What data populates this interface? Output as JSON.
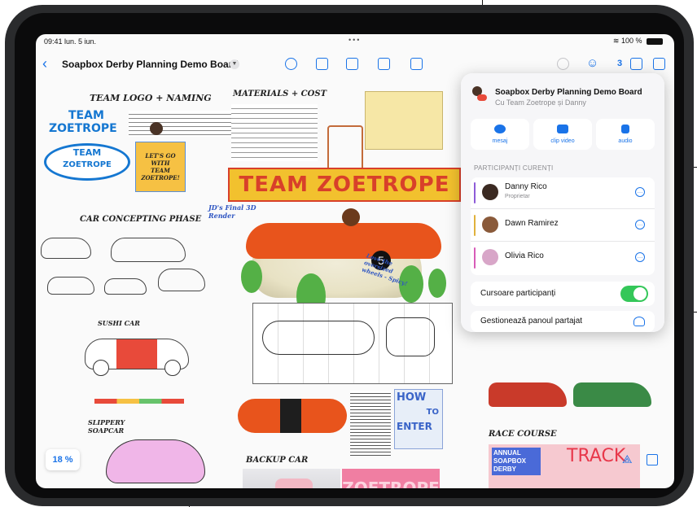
{
  "status": {
    "time": "09:41 lun. 5 iun.",
    "battery": "100 %"
  },
  "toolbar": {
    "back_glyph": "‹",
    "title": "Soapbox Derby Planning Demo Board",
    "collaborator_count": "3"
  },
  "canvas": {
    "team_logo_heading": "TEAM LOGO + NAMING",
    "team_logo_line1": "TEAM",
    "team_logo_line2": "ZOETROPE",
    "team_badge_line1": "TEAM",
    "team_badge_line2": "ZOETROPE",
    "sticky_text": "LET'S GO WITH TEAM ZOETROPE!",
    "car_concepting": "CAR CONCEPTING PHASE",
    "sushi_car": "SUSHI CAR",
    "slippery_soapcar": "SLIPPERY SOAPCAR",
    "materials_cost": "MATERIALS + COST",
    "team_zoetrope_banner": "TEAM ZOETROPE",
    "final_3d": "JD's Final 3D Render",
    "love_wheels": "Love the oversized wheels - Spicy!",
    "backup_car": "BACKUP CAR",
    "backup_logo": "ZOETROPE",
    "how_to_enter_1": "HOW",
    "how_to_enter_2": "TO",
    "how_to_enter_3": "ENTER",
    "race_course": "RACE COURSE",
    "annual_derby": "ANNUAL SOAPBOX DERBY",
    "track": "TRACK"
  },
  "zoom": "18 %",
  "panel": {
    "board_title": "Soapbox Derby Planning Demo Board",
    "board_subtitle": "Cu Team Zoetrope și Danny",
    "buttons": [
      {
        "label": "mesaj",
        "icon": "message-icon"
      },
      {
        "label": "clip video",
        "icon": "video-icon"
      },
      {
        "label": "audio",
        "icon": "phone-icon"
      }
    ],
    "section_label": "PARTICIPANȚI CURENȚI",
    "participants": [
      {
        "name": "Danny Rico",
        "role": "Proprietar",
        "color": "#8e5cd8"
      },
      {
        "name": "Dawn Ramirez",
        "role": "",
        "color": "#e0b23c"
      },
      {
        "name": "Olivia Rico",
        "role": "",
        "color": "#d85cb8"
      }
    ],
    "cursors_label": "Cursoare participanți",
    "cursors_on": true,
    "manage_label": "Gestionează panoul partajat"
  },
  "colors": {
    "accent": "#1a73e8",
    "toggle_on": "#34c759",
    "banner_red": "#d8402a",
    "banner_yellow": "#f2c12e"
  }
}
